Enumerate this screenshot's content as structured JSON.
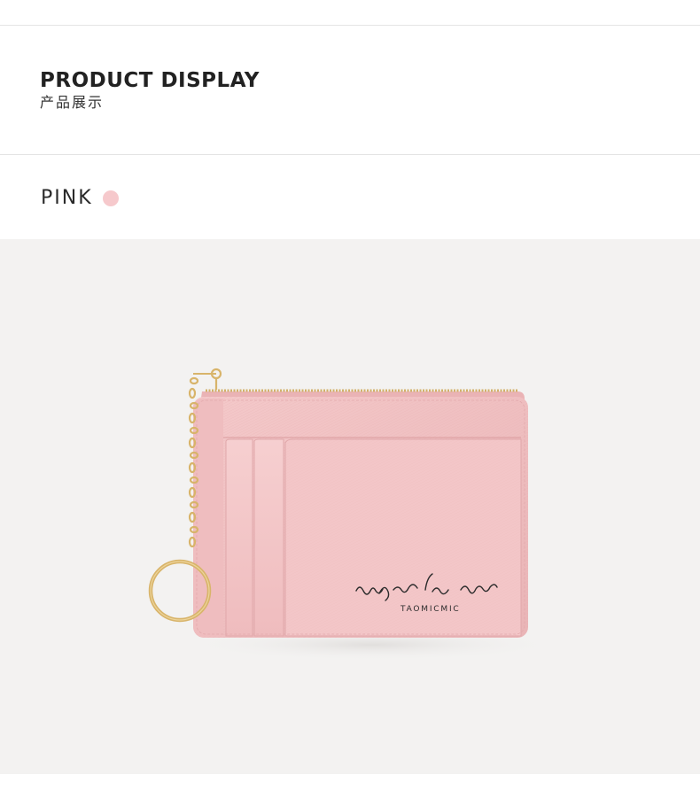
{
  "header": {
    "title": "PRODUCT DISPLAY",
    "subtitle": "产品展示"
  },
  "color_option": {
    "label": "PINK",
    "swatch_color": "#f6c9cc"
  },
  "product": {
    "script_text": "un jour de chance",
    "brand_text": "TAOMICMIC",
    "body_color": "#f1c2c3",
    "hardware_color": "#d8b46a"
  }
}
